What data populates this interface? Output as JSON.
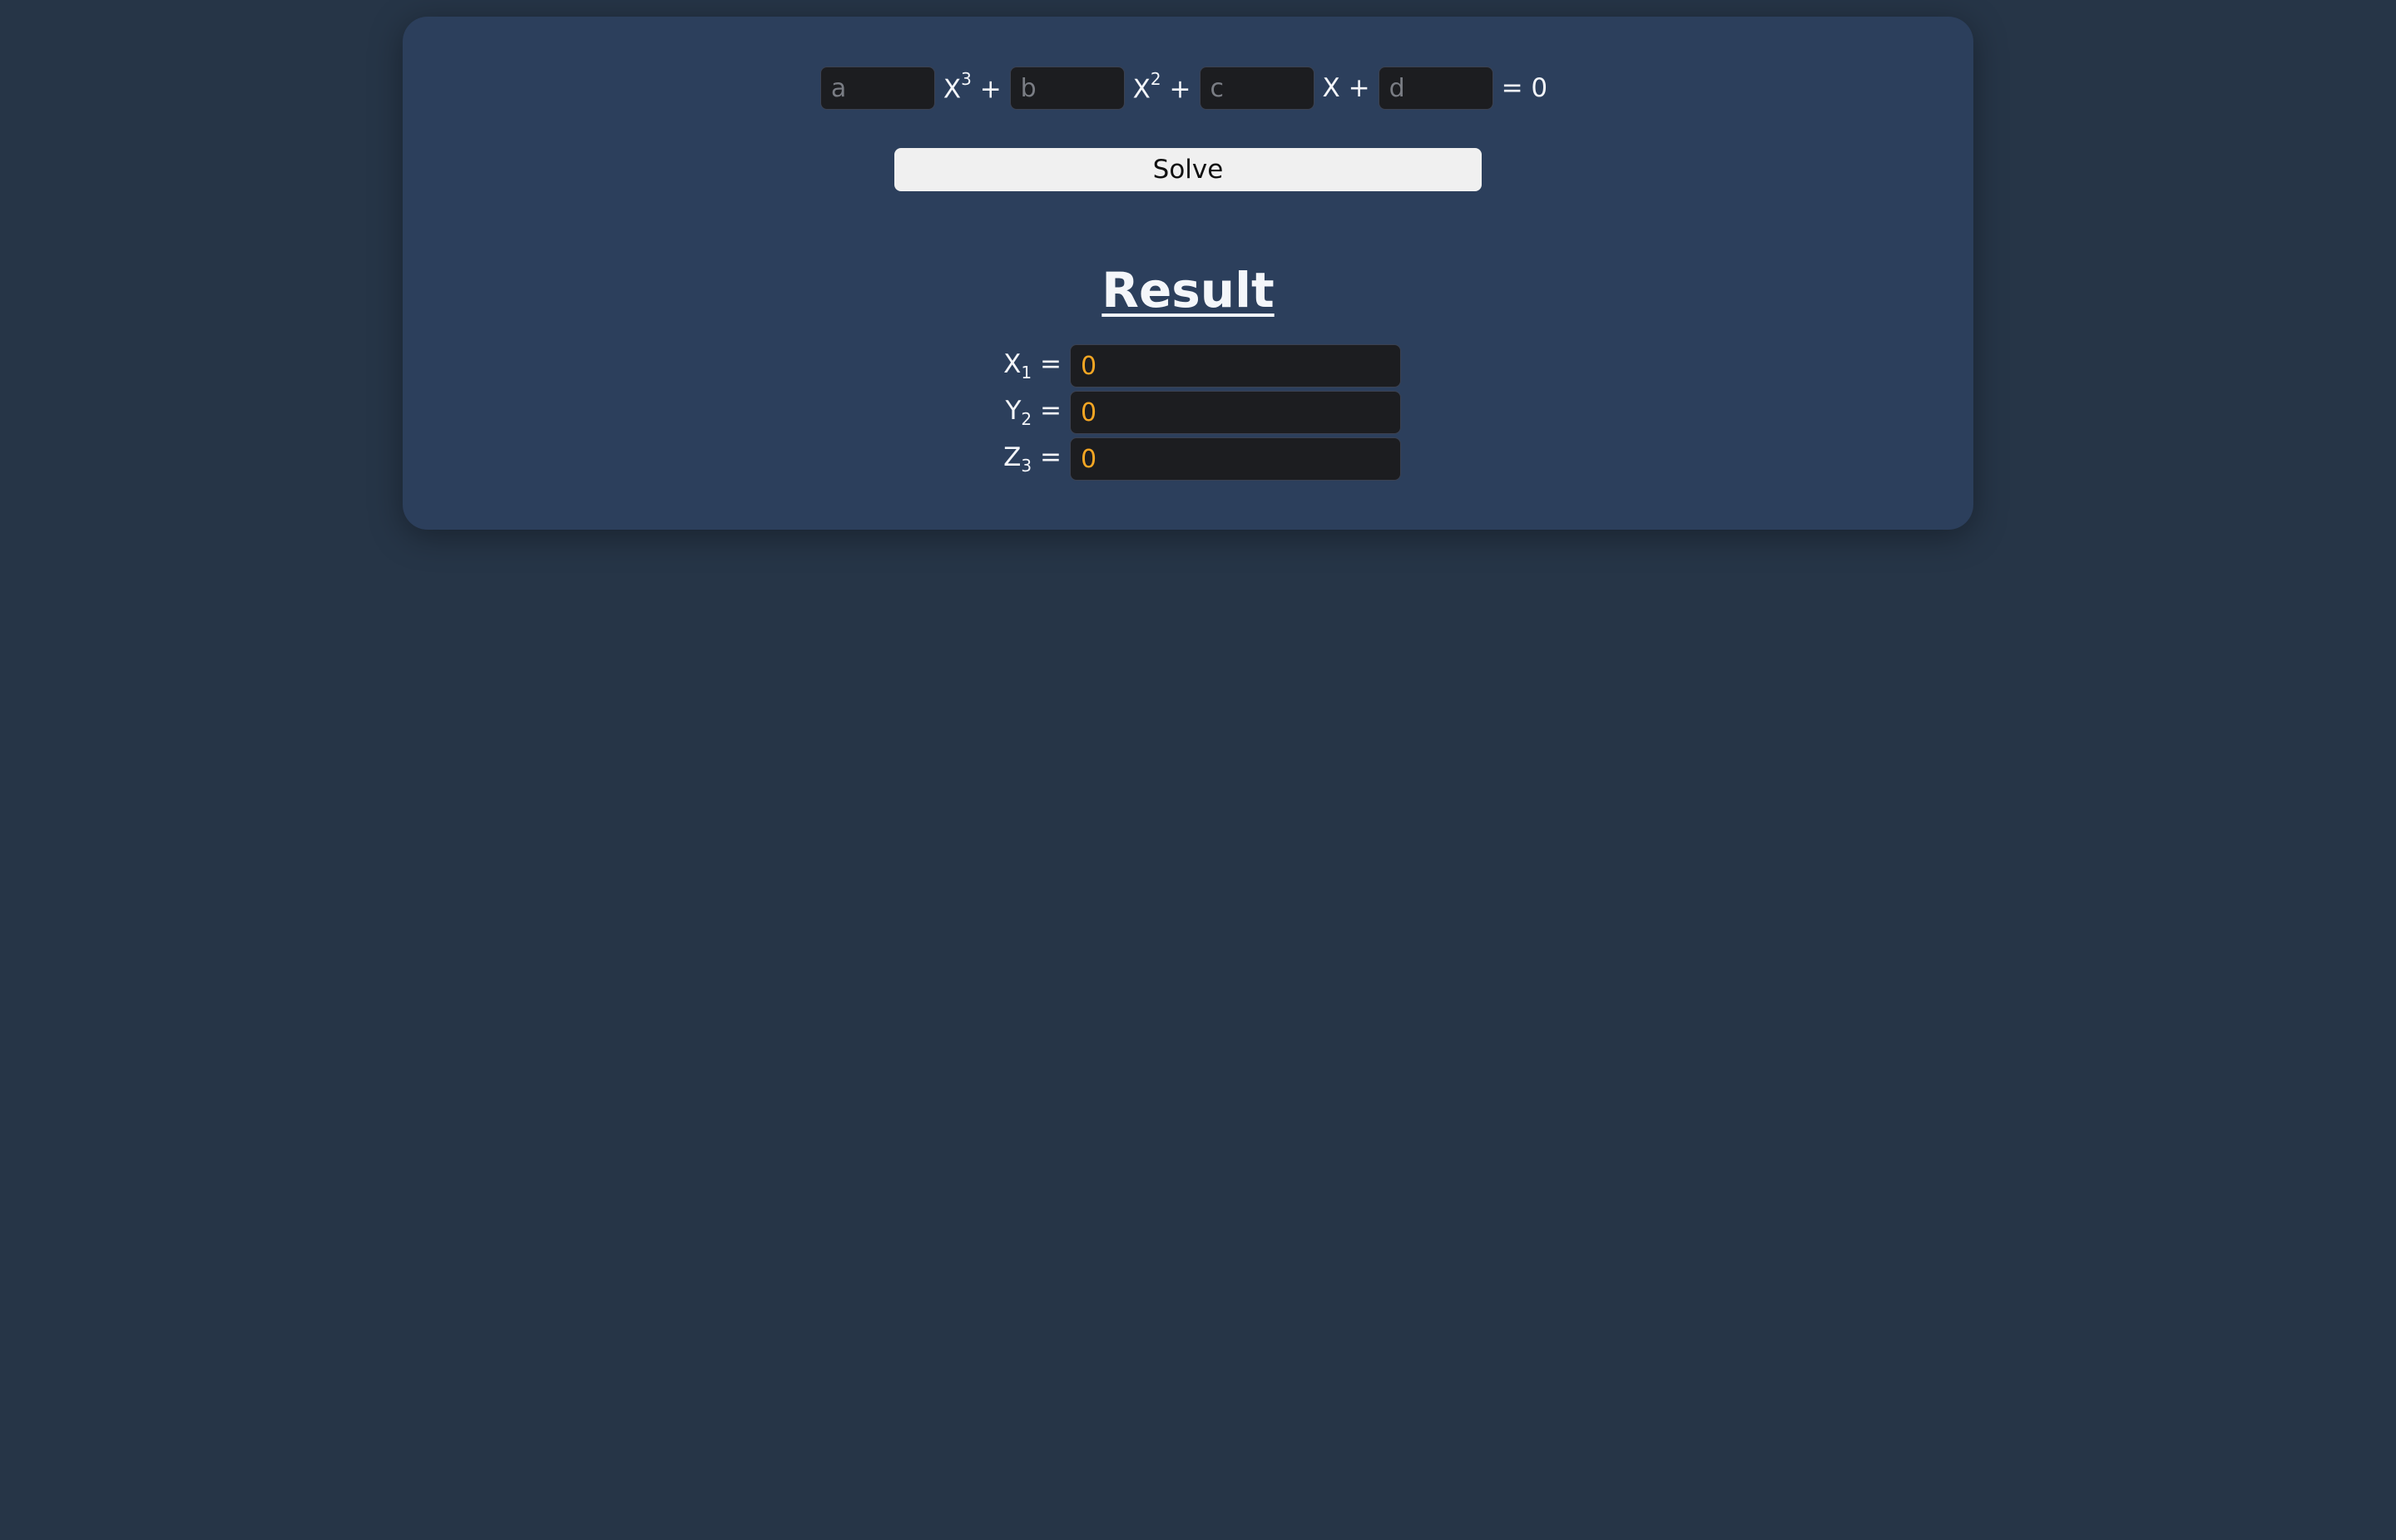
{
  "equation": {
    "a_placeholder": "a",
    "b_placeholder": "b",
    "c_placeholder": "c",
    "d_placeholder": "d",
    "term_x": "X",
    "exp3": "3",
    "exp2": "2",
    "plus": "+",
    "equals_zero": "= 0"
  },
  "solve_button": {
    "label": "Solve"
  },
  "result": {
    "title": "Result",
    "rows": [
      {
        "var": "X",
        "sub": "1",
        "eq": "=",
        "value": "0"
      },
      {
        "var": "Y",
        "sub": "2",
        "eq": "=",
        "value": "0"
      },
      {
        "var": "Z",
        "sub": "3",
        "eq": "=",
        "value": "0"
      }
    ]
  },
  "colors": {
    "background": "#263547",
    "card": "#2c3f5c",
    "input_bg": "#1c1d20",
    "result_value": "#f5a623",
    "button_bg": "#f0f0f0"
  }
}
